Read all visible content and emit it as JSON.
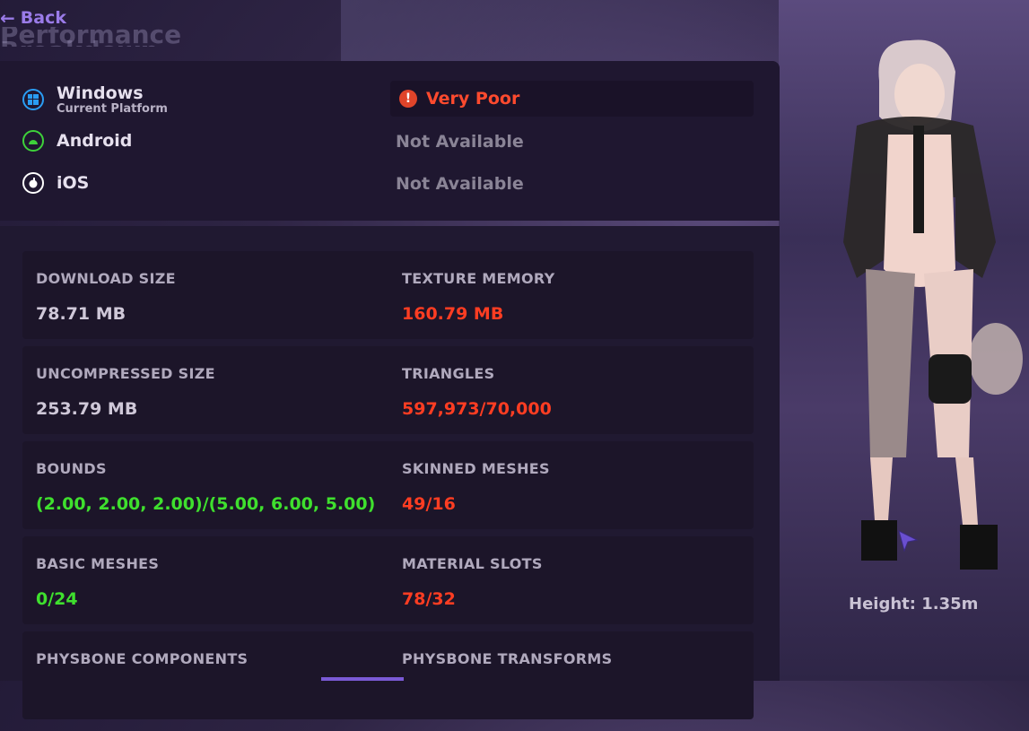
{
  "header": {
    "back_label": "Back",
    "ghost_title": "Performance Breakdown"
  },
  "platforms": [
    {
      "name": "Windows",
      "sub": "Current Platform",
      "icon": "windows-icon",
      "rating": "Very Poor"
    },
    {
      "name": "Android",
      "sub": "",
      "icon": "android-icon",
      "rating": "Not Available"
    },
    {
      "name": "iOS",
      "sub": "",
      "icon": "apple-icon",
      "rating": "Not Available"
    }
  ],
  "stats": {
    "download_size": {
      "label": "DOWNLOAD SIZE",
      "value": "78.71 MB"
    },
    "texture_memory": {
      "label": "TEXTURE MEMORY",
      "value": "160.79 MB"
    },
    "uncompressed_size": {
      "label": "UNCOMPRESSED SIZE",
      "value": "253.79 MB"
    },
    "triangles": {
      "label": "TRIANGLES",
      "value": "597,973/70,000"
    },
    "bounds": {
      "label": "BOUNDS",
      "value": "(2.00, 2.00, 2.00)/(5.00, 6.00, 5.00)"
    },
    "skinned_meshes": {
      "label": "SKINNED MESHES",
      "value": "49/16"
    },
    "basic_meshes": {
      "label": "BASIC MESHES",
      "value": "0/24"
    },
    "material_slots": {
      "label": "MATERIAL SLOTS",
      "value": "78/32"
    },
    "physbone_components": {
      "label": "PHYSBONE COMPONENTS",
      "value": ""
    },
    "physbone_transforms": {
      "label": "PHYSBONE TRANSFORMS",
      "value": ""
    }
  },
  "avatar": {
    "height_label": "Height: 1.35m"
  },
  "colors": {
    "accent": "#9a7be8",
    "bad": "#ff3d22",
    "good": "#3fe02e",
    "neutral": "#cfc8d8"
  }
}
